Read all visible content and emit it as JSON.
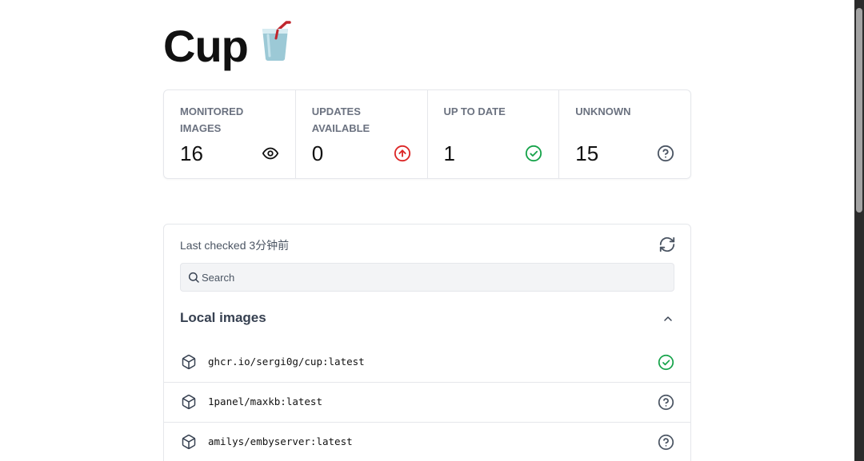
{
  "app": {
    "title": "Cup"
  },
  "stats": [
    {
      "label": "MONITORED IMAGES",
      "value": "16",
      "icon": "eye-icon",
      "color": "#111111"
    },
    {
      "label": "UPDATES AVAILABLE",
      "value": "0",
      "icon": "arrow-up-circle-icon",
      "color": "#dc2626"
    },
    {
      "label": "UP TO DATE",
      "value": "1",
      "icon": "check-circle-icon",
      "color": "#16a34a"
    },
    {
      "label": "UNKNOWN",
      "value": "15",
      "icon": "help-circle-icon",
      "color": "#4b5563"
    }
  ],
  "list": {
    "last_checked": "Last checked 3分钟前",
    "search_placeholder": "Search",
    "section_title": "Local images",
    "images": [
      {
        "name": "ghcr.io/sergi0g/cup:latest",
        "status": "up-to-date",
        "status_icon": "check-circle-icon"
      },
      {
        "name": "1panel/maxkb:latest",
        "status": "unknown",
        "status_icon": "help-circle-icon"
      },
      {
        "name": "amilys/embyserver:latest",
        "status": "unknown",
        "status_icon": "help-circle-icon"
      }
    ]
  },
  "colors": {
    "success": "#16a34a",
    "danger": "#dc2626",
    "muted": "#4b5563",
    "border": "#e5e7eb"
  }
}
